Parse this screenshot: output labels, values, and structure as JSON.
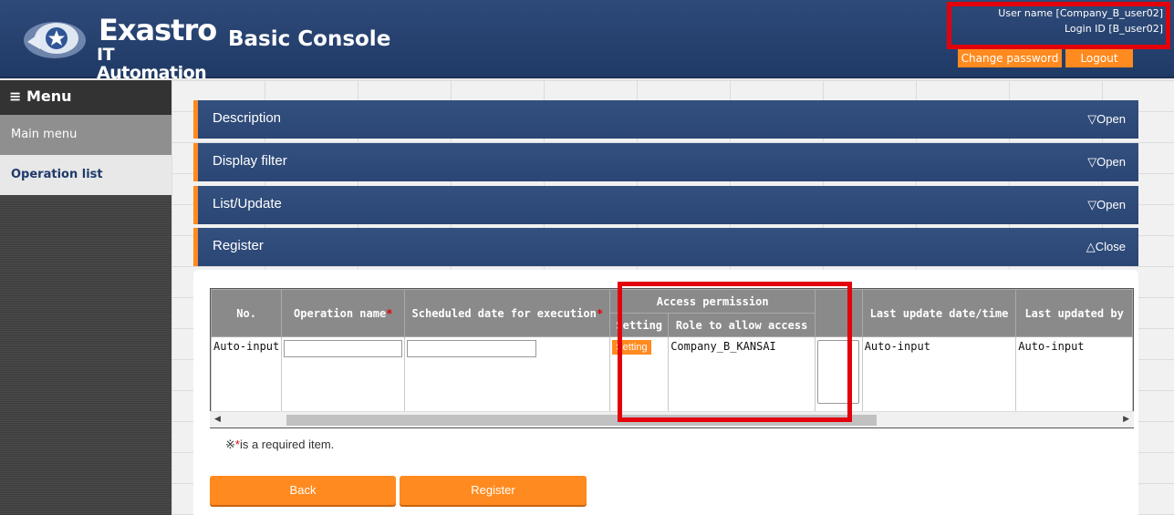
{
  "header": {
    "logo_word": "Exastro",
    "logo_sub": "IT Automation",
    "console_title": "Basic Console",
    "user_name": "User name [Company_B_user02]",
    "login_id": "Login ID [B_user02]",
    "change_password_label": "Change password",
    "logout_label": "Logout"
  },
  "sidebar": {
    "menu_title": "≡ Menu",
    "items": [
      {
        "label": "Main menu"
      },
      {
        "label": "Operation list"
      }
    ]
  },
  "sections": [
    {
      "label": "Description",
      "toggle": "▽Open"
    },
    {
      "label": "Display filter",
      "toggle": "▽Open"
    },
    {
      "label": "List/Update",
      "toggle": "▽Open"
    },
    {
      "label": "Register",
      "toggle": "△Close"
    }
  ],
  "register_table": {
    "headers": {
      "no": "No.",
      "operation_name": "Operation name",
      "scheduled_date": "Scheduled date for execution",
      "access_permission": "Access permission",
      "setting": "Setting",
      "role": "Role to allow access",
      "last_update": "Last update date/time",
      "last_updated_by": "Last updated by"
    },
    "required_mark": "*",
    "row": {
      "no": "Auto-input",
      "setting_button": "Setting",
      "role": "Company_B_KANSAI",
      "last_update": "Auto-input",
      "last_updated_by": "Auto-input"
    }
  },
  "required_note": {
    "prefix": "※",
    "mark": "*",
    "text": "is a required item."
  },
  "buttons": {
    "back": "Back",
    "register": "Register"
  },
  "colors": {
    "header_bg": "#2b4674",
    "accent_orange": "#ff8a1f",
    "highlight_red": "#e3000b"
  }
}
